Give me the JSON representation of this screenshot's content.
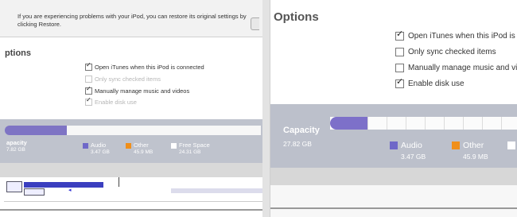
{
  "restore": {
    "message": "If you are experiencing problems with your iPod, you can restore its original settings by clicking Restore."
  },
  "options": {
    "title": "Options",
    "left_title": "ptions",
    "items": [
      {
        "label": "Open iTunes when this iPod is connected",
        "checked": true,
        "enabled": true
      },
      {
        "label": "Only sync checked items",
        "checked": false,
        "enabled": false
      },
      {
        "label": "Manually manage music and videos",
        "checked": true,
        "enabled": true
      },
      {
        "label": "Enable disk use",
        "checked": true,
        "enabled": false
      }
    ],
    "right_items": [
      {
        "label": "Open iTunes when this iPod is",
        "checked": true
      },
      {
        "label": "Only sync checked items",
        "checked": false
      },
      {
        "label": "Manually manage music and vid",
        "checked": false
      },
      {
        "label": "Enable disk use",
        "checked": true
      }
    ]
  },
  "capacity": {
    "label": "Capacity",
    "left_label": "apacity",
    "total": "27.82 GB",
    "left_total": "7.82 GB",
    "audio": {
      "label": "Audio",
      "size": "3.47 GB",
      "color": "#6f68c8"
    },
    "other": {
      "label": "Other",
      "size": "45.9 MB",
      "color": "#f08f1a"
    },
    "free": {
      "label": "Free Space",
      "size": "24.31 GB",
      "color": "#ffffff"
    }
  }
}
